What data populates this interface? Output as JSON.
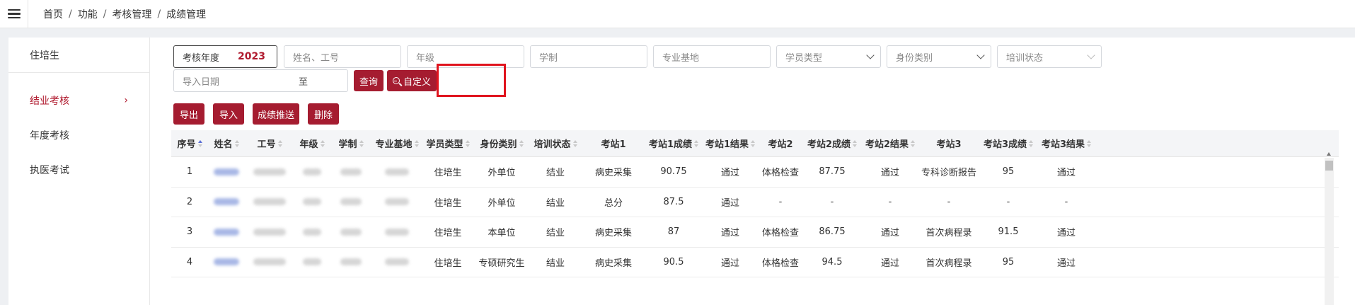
{
  "breadcrumb": [
    "首页",
    "功能",
    "考核管理",
    "成绩管理"
  ],
  "sidebar": {
    "header": "住培生",
    "items": [
      {
        "label": "结业考核",
        "active": true
      },
      {
        "label": "年度考核",
        "active": false
      },
      {
        "label": "执医考试",
        "active": false
      }
    ]
  },
  "filters": {
    "year_label": "考核年度",
    "year_value": "2023",
    "name_placeholder": "姓名、工号",
    "grade_placeholder": "年级",
    "system_placeholder": "学制",
    "base_placeholder": "专业基地",
    "student_type_placeholder": "学员类型",
    "identity_placeholder": "身份类别",
    "training_status_placeholder": "培训状态",
    "import_date_placeholder": "导入日期",
    "date_sep": "至"
  },
  "buttons": {
    "query": "查询",
    "custom": "自定义",
    "export": "导出",
    "import": "导入",
    "push": "成绩推送",
    "delete": "删除"
  },
  "table": {
    "columns": [
      "序号",
      "姓名",
      "工号",
      "年级",
      "学制",
      "专业基地",
      "学员类型",
      "身份类别",
      "培训状态",
      "考站1",
      "考站1成绩",
      "考站1结果",
      "考站2",
      "考站2成绩",
      "考站2结果",
      "考站3",
      "考站3成绩",
      "考站3结果"
    ],
    "rows": [
      {
        "no": "1",
        "type": "住培生",
        "identity": "外单位",
        "status": "结业",
        "s1": "病史采集",
        "s1_score": "90.75",
        "s1_result": "通过",
        "s2": "体格检查",
        "s2_score": "87.75",
        "s2_result": "通过",
        "s3": "专科诊断报告",
        "s3_score": "95",
        "s3_result": "通过"
      },
      {
        "no": "2",
        "type": "住培生",
        "identity": "外单位",
        "status": "结业",
        "s1": "总分",
        "s1_score": "87.5",
        "s1_result": "通过",
        "s2": "-",
        "s2_score": "-",
        "s2_result": "-",
        "s3": "-",
        "s3_score": "-",
        "s3_result": "-"
      },
      {
        "no": "3",
        "type": "住培生",
        "identity": "本单位",
        "status": "结业",
        "s1": "病史采集",
        "s1_score": "87",
        "s1_result": "通过",
        "s2": "体格检查",
        "s2_score": "86.75",
        "s2_result": "通过",
        "s3": "首次病程录",
        "s3_score": "91.5",
        "s3_result": "通过"
      },
      {
        "no": "4",
        "type": "住培生",
        "identity": "专硕研究生",
        "status": "结业",
        "s1": "病史采集",
        "s1_score": "90.5",
        "s1_result": "通过",
        "s2": "体格检查",
        "s2_score": "94.5",
        "s2_result": "通过",
        "s3": "首次病程录",
        "s3_score": "95",
        "s3_result": "通过"
      }
    ]
  }
}
